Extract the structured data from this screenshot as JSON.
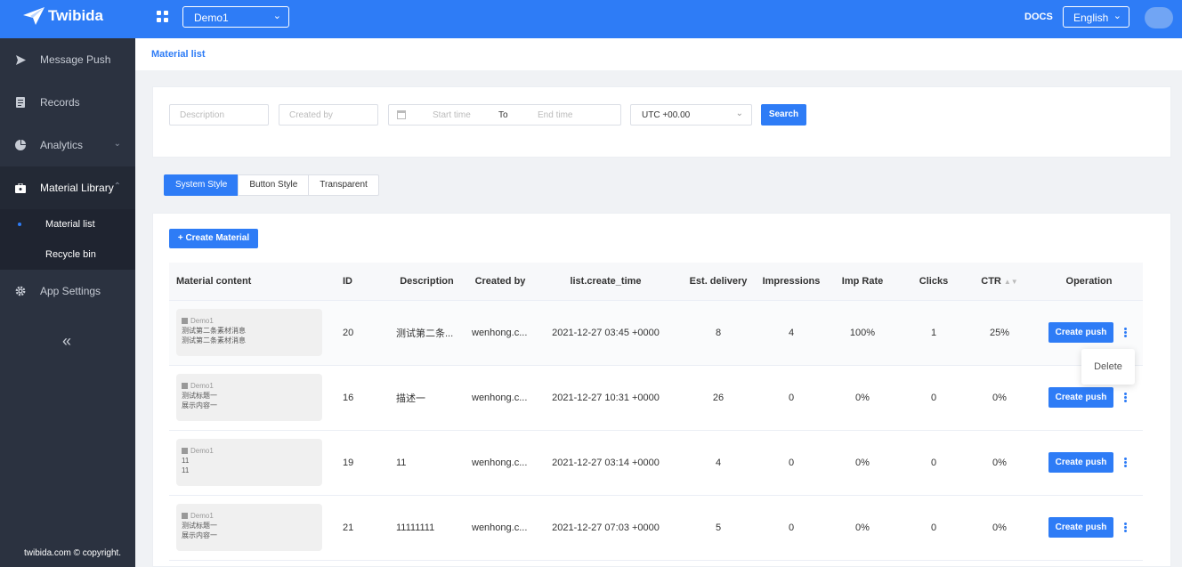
{
  "header": {
    "brand": "Twibida",
    "app_selected": "Demo1",
    "docs_label": "DOCS",
    "language": "English"
  },
  "sidebar": {
    "items": [
      {
        "label": "Message Push",
        "icon": "send-icon"
      },
      {
        "label": "Records",
        "icon": "document-icon"
      },
      {
        "label": "Analytics",
        "icon": "pie-chart-icon"
      },
      {
        "label": "Material Library",
        "icon": "briefcase-icon"
      },
      {
        "label": "App Settings",
        "icon": "gear-icon"
      }
    ],
    "submenu": [
      "Material list",
      "Recycle bin"
    ],
    "collapse_glyph": "«",
    "copyright": "twibida.com © copyright."
  },
  "breadcrumb": "Material list",
  "filters": {
    "description_placeholder": "Description",
    "created_by_placeholder": "Created by",
    "start_placeholder": "Start time",
    "to_label": "To",
    "end_placeholder": "End time",
    "timezone": "UTC +00.00",
    "search_label": "Search"
  },
  "tabs": [
    "System Style",
    "Button Style",
    "Transparent"
  ],
  "create_label": "+ Create Material",
  "table": {
    "headers": [
      "Material content",
      "ID",
      "Description",
      "Created by",
      "list.create_time",
      "Est. delivery",
      "Impressions",
      "Imp Rate",
      "Clicks",
      "CTR",
      "Operation"
    ],
    "push_label": "Create push",
    "rows": [
      {
        "app": "Demo1",
        "title": "测试第二条素材消息",
        "body": "测试第二条素材消息",
        "id": "20",
        "description": "测试第二条...",
        "created_by": "wenhong.c...",
        "create_time": "2021-12-27 03:45 +0000",
        "est_delivery": "8",
        "impressions": "4",
        "imp_rate": "100%",
        "clicks": "1",
        "ctr": "25%"
      },
      {
        "app": "Demo1",
        "title": "测试标题一",
        "body": "展示内容一",
        "id": "16",
        "description": "描述一",
        "created_by": "wenhong.c...",
        "create_time": "2021-12-27 10:31 +0000",
        "est_delivery": "26",
        "impressions": "0",
        "imp_rate": "0%",
        "clicks": "0",
        "ctr": "0%"
      },
      {
        "app": "Demo1",
        "title": "11",
        "body": "11",
        "id": "19",
        "description": "11",
        "created_by": "wenhong.c...",
        "create_time": "2021-12-27 03:14 +0000",
        "est_delivery": "4",
        "impressions": "0",
        "imp_rate": "0%",
        "clicks": "0",
        "ctr": "0%"
      },
      {
        "app": "Demo1",
        "title": "测试标题一",
        "body": "展示内容一",
        "id": "21",
        "description": "11111111",
        "created_by": "wenhong.c...",
        "create_time": "2021-12-27 07:03 +0000",
        "est_delivery": "5",
        "impressions": "0",
        "imp_rate": "0%",
        "clicks": "0",
        "ctr": "0%"
      }
    ]
  },
  "dropdown": {
    "delete_label": "Delete"
  },
  "colors": {
    "primary": "#2e7cf6",
    "sidebar": "#2b3240"
  }
}
